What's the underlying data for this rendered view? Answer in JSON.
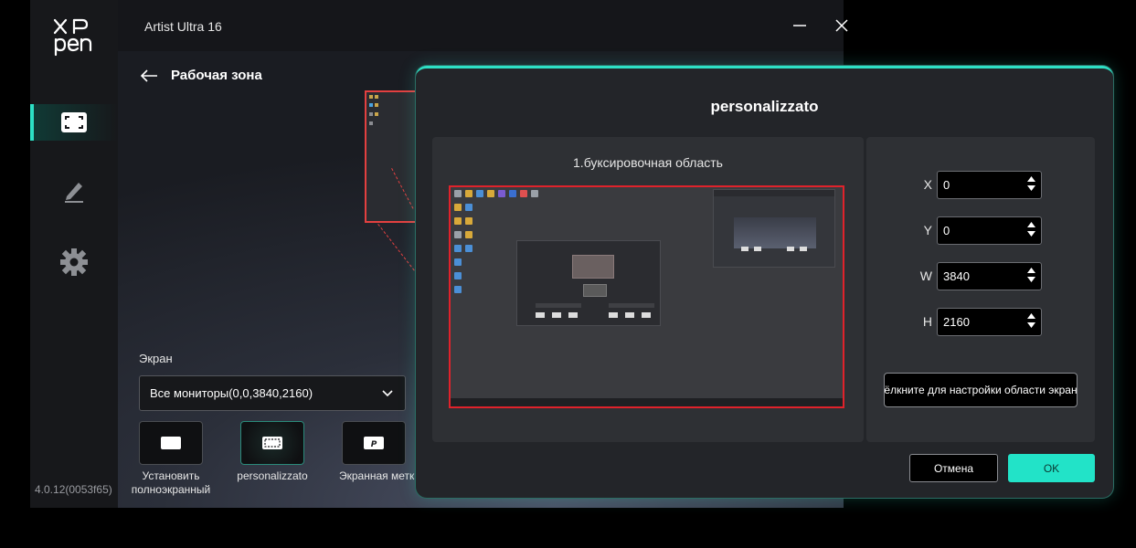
{
  "app": {
    "title": "Artist Ultra 16",
    "version": "4.0.12(0053f65)"
  },
  "sidebar": {
    "items": [
      {
        "icon": "work-area-icon",
        "active": true
      },
      {
        "icon": "pen-icon",
        "active": false
      },
      {
        "icon": "gear-icon",
        "active": false
      }
    ]
  },
  "page": {
    "title": "Рабочая зона",
    "screen_label": "Экран",
    "screen_select_value": "Все мониторы(0,0,3840,2160)",
    "modes": [
      {
        "label_line1": "Установить",
        "label_line2": "полноэкранный"
      },
      {
        "label_line1": "personalizzato",
        "label_line2": ""
      },
      {
        "label_line1": "Экранная метк",
        "label_line2": ""
      }
    ]
  },
  "dialog": {
    "title": "personalizzato",
    "area_title": "1.буксировочная область",
    "fields": [
      {
        "label": "X",
        "value": "0"
      },
      {
        "label": "Y",
        "value": "0"
      },
      {
        "label": "W",
        "value": "3840"
      },
      {
        "label": "H",
        "value": "2160"
      }
    ],
    "set_area_button": "ёлкните для настройки области экран",
    "cancel": "Отмена",
    "ok": "OK"
  },
  "colors": {
    "accent": "#2de0c5",
    "selection_border": "#e0222b",
    "ok_button": "#22e3c8"
  }
}
